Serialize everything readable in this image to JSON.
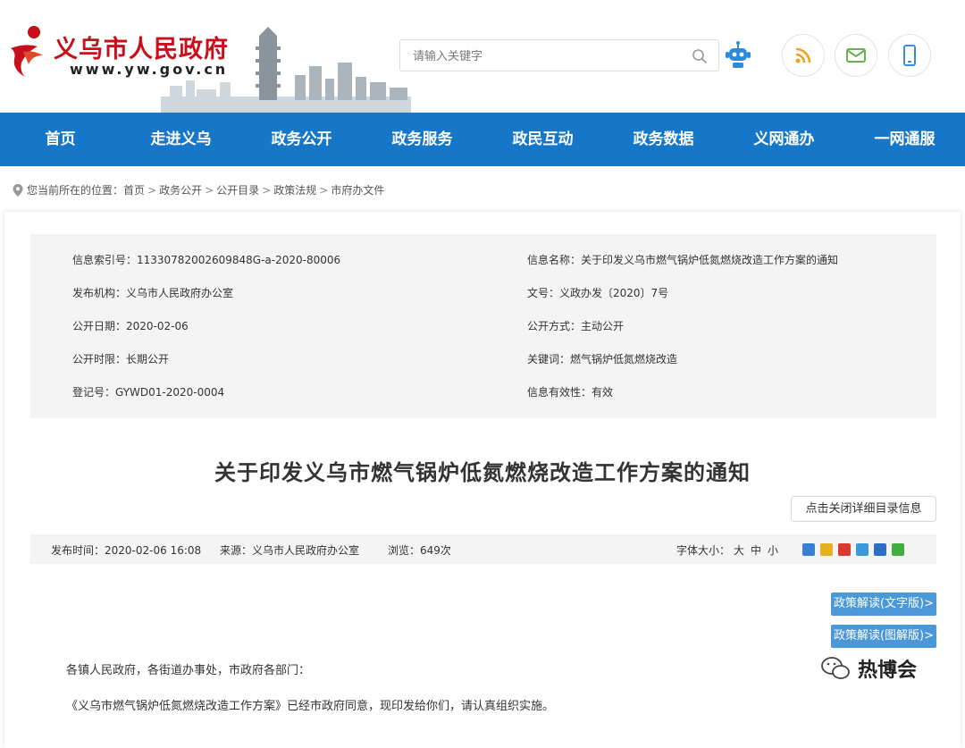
{
  "header": {
    "site_title": "义乌市人民政府",
    "site_url": "www.yw.gov.cn",
    "search_placeholder": "请输入关键字"
  },
  "nav": [
    {
      "label": "首页"
    },
    {
      "label": "走进义乌"
    },
    {
      "label": "政务公开"
    },
    {
      "label": "政务服务"
    },
    {
      "label": "政民互动"
    },
    {
      "label": "政务数据"
    },
    {
      "label": "义网通办"
    },
    {
      "label": "一网通服"
    }
  ],
  "breadcrumb": {
    "prefix": "您当前所在的位置：",
    "items": [
      "首页",
      "政务公开",
      "公开目录",
      "政策法规",
      "市府办文件"
    ]
  },
  "meta": {
    "index_no": "信息索引号：11330782002609848G-a-2020-80006",
    "info_name": "信息名称：关于印发义乌市燃气锅炉低氮燃烧改造工作方案的通知",
    "publisher": "发布机构：义乌市人民政府办公室",
    "doc_no": "文号：义政办发〔2020〕7号",
    "public_date": "公开日期：2020-02-06",
    "public_mode": "公开方式：主动公开",
    "public_term": "公开时限：长期公开",
    "keywords": "关键词：燃气锅炉低氮燃烧改造",
    "reg_no": "登记号：GYWD01-2020-0004",
    "validity": "信息有效性：有效"
  },
  "article": {
    "title": "关于印发义乌市燃气锅炉低氮燃烧改造工作方案的通知",
    "toggle_label": "点击关闭详细目录信息",
    "publish_time": "发布时间：2020-02-06 16:08",
    "source": "来源：义乌市人民政府办公室",
    "views": "浏览：649次",
    "font_size_label": "字体大小：",
    "size_large": "大",
    "size_medium": "中",
    "size_small": "小",
    "interp_text": "政策解读(文字版)>",
    "interp_image": "政策解读(图解版)>",
    "para1": "各镇人民政府，各街道办事处，市政府各部门：",
    "para2": "《义乌市燃气锅炉低氮燃烧改造工作方案》已经市政府同意，现印发给你们，请认真组织实施。"
  },
  "watermark": {
    "text": "热博会"
  },
  "colors": {
    "nav_bg": "#1677c9",
    "logo_red": "#c8101c",
    "button_blue": "#4a98d8"
  }
}
